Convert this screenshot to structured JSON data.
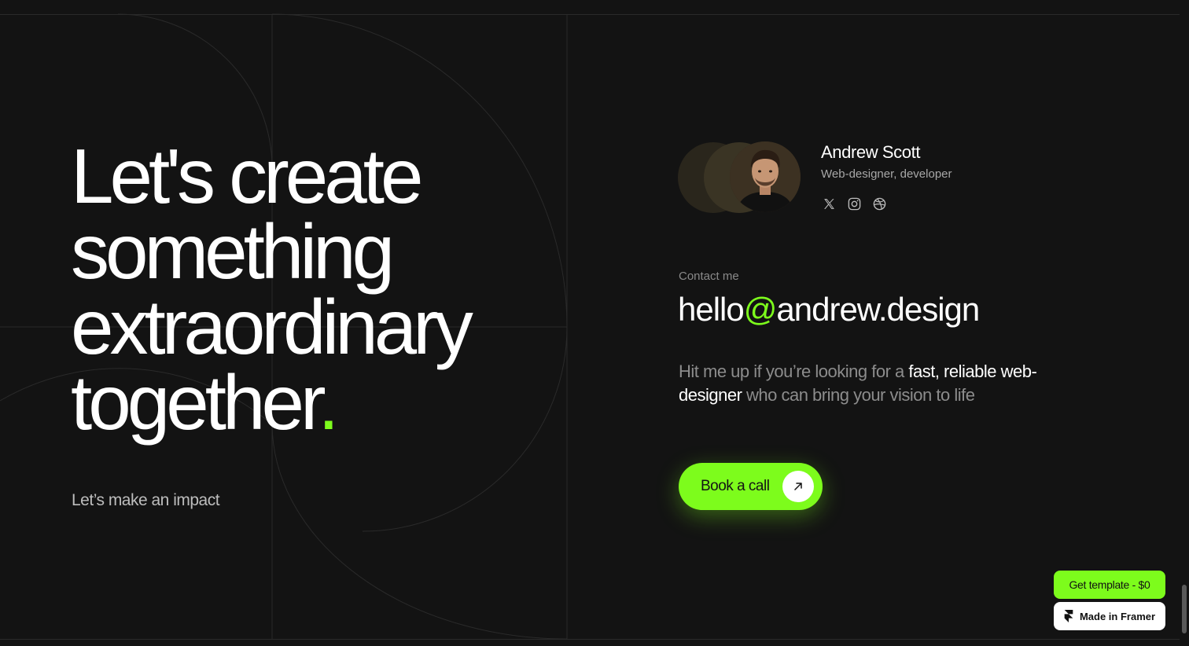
{
  "hero": {
    "lines": [
      "Let's create",
      "something",
      "extraordinary",
      "together"
    ],
    "period": ".",
    "subline": "Let’s make an impact"
  },
  "profile": {
    "name": "Andrew Scott",
    "role": "Web-designer, developer",
    "socials": [
      {
        "name": "x-icon"
      },
      {
        "name": "instagram-icon"
      },
      {
        "name": "dribbble-icon"
      }
    ]
  },
  "contact": {
    "label": "Contact me",
    "email_user": "hello",
    "email_at": "@",
    "email_domain": "andrew.design"
  },
  "pitch": {
    "part1": "Hit me up if you’re looking for a ",
    "highlight1": "fast, reliable web-designer",
    "part2": " who can bring your vision to life"
  },
  "cta": {
    "label": "Book a call",
    "icon": "arrow-up-right-icon"
  },
  "badges": {
    "template": "Get template - $0",
    "framer": "Made in Framer"
  },
  "colors": {
    "background": "#131313",
    "accent": "#7dfc1c",
    "text": "#ffffff",
    "muted": "#8c8c8c"
  }
}
